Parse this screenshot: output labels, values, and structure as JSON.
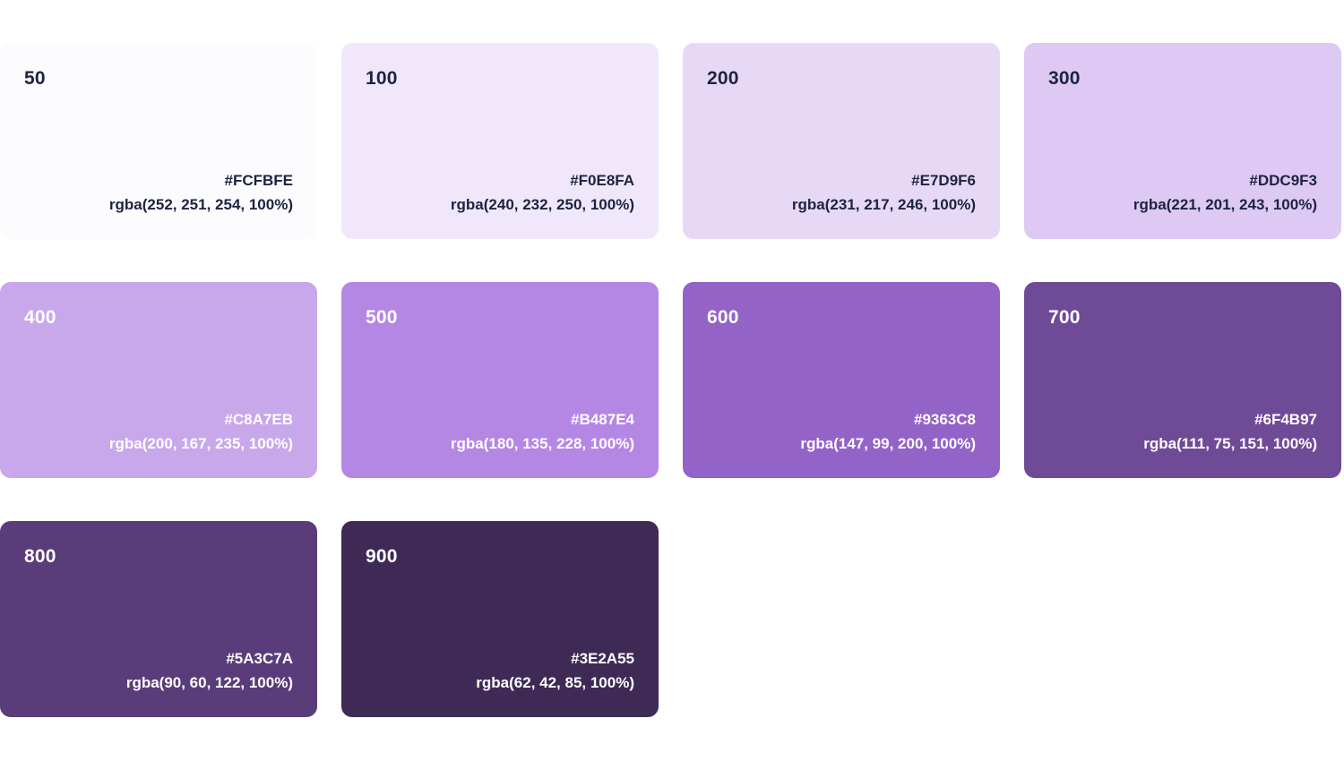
{
  "swatches": [
    {
      "shade": "50",
      "hex": "#FCFBFE",
      "rgba": "rgba(252, 251, 254, 100%)",
      "color": "#FCFBFE",
      "text": "dark"
    },
    {
      "shade": "100",
      "hex": "#F0E8FA",
      "rgba": "rgba(240, 232, 250, 100%)",
      "color": "#F0E8FA",
      "text": "dark"
    },
    {
      "shade": "200",
      "hex": "#E7D9F6",
      "rgba": "rgba(231, 217, 246, 100%)",
      "color": "#E7D9F6",
      "text": "dark"
    },
    {
      "shade": "300",
      "hex": "#DDC9F3",
      "rgba": "rgba(221, 201, 243, 100%)",
      "color": "#DDC9F3",
      "text": "dark"
    },
    {
      "shade": "400",
      "hex": "#C8A7EB",
      "rgba": "rgba(200, 167, 235, 100%)",
      "color": "#C8A7EB",
      "text": "light"
    },
    {
      "shade": "500",
      "hex": "#B487E4",
      "rgba": "rgba(180, 135, 228, 100%)",
      "color": "#B487E4",
      "text": "light"
    },
    {
      "shade": "600",
      "hex": "#9363C8",
      "rgba": "rgba(147, 99, 200, 100%)",
      "color": "#9363C8",
      "text": "light"
    },
    {
      "shade": "700",
      "hex": "#6F4B97",
      "rgba": "rgba(111, 75, 151, 100%)",
      "color": "#6F4B97",
      "text": "light"
    },
    {
      "shade": "800",
      "hex": "#5A3C7A",
      "rgba": "rgba(90, 60, 122, 100%)",
      "color": "#5A3C7A",
      "text": "light"
    },
    {
      "shade": "900",
      "hex": "#3E2A55",
      "rgba": "rgba(62, 42, 85, 100%)",
      "color": "#3E2A55",
      "text": "light"
    }
  ]
}
